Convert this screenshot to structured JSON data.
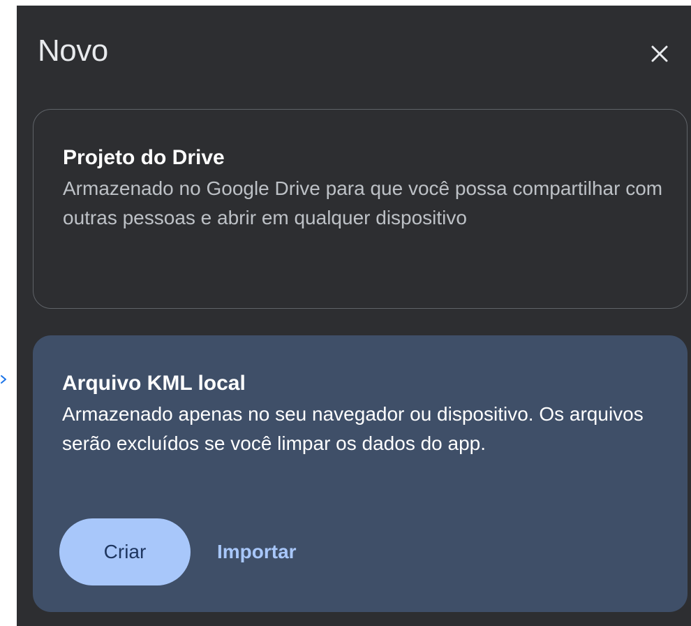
{
  "dialog": {
    "title": "Novo",
    "close_icon": "close-icon"
  },
  "options": {
    "drive": {
      "title": "Projeto do Drive",
      "description": "Armazenado no Google Drive para que você possa compartilhar com outras pessoas e abrir em qualquer dispositivo"
    },
    "kml": {
      "title": "Arquivo KML local",
      "description": "Armazenado apenas no seu navegador ou dispositivo. Os arquivos serão excluídos se você limpar os dados do app.",
      "create_label": "Criar",
      "import_label": "Importar"
    }
  },
  "colors": {
    "panel_bg": "#2d2e31",
    "selected_card_bg": "#3f4f68",
    "primary_button": "#a8c7fa",
    "text_link": "#a8c7fa"
  }
}
